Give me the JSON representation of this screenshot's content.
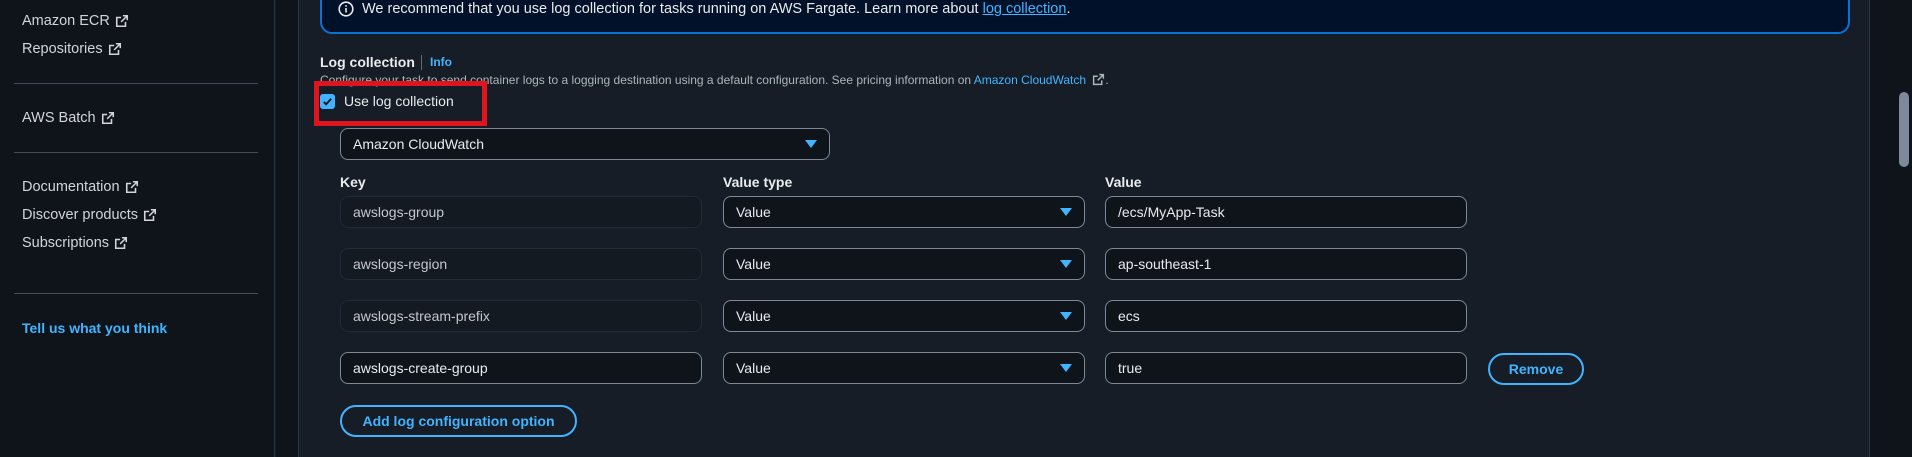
{
  "sidebar": {
    "items_top": [
      {
        "label": "Amazon ECR"
      },
      {
        "label": "Repositories"
      }
    ],
    "items_mid": [
      {
        "label": "AWS Batch"
      }
    ],
    "items_bottom": [
      {
        "label": "Documentation"
      },
      {
        "label": "Discover products"
      },
      {
        "label": "Subscriptions"
      }
    ],
    "feedback": "Tell us what you think"
  },
  "alert": {
    "text": "We recommend that you use log collection for tasks running on AWS Fargate. Learn more about ",
    "link": "log collection",
    "suffix": "."
  },
  "log_collection": {
    "title": "Log collection",
    "info": "Info",
    "description": "Configure your task to send container logs to a logging destination using a default configuration. See pricing information on ",
    "description_link": "Amazon CloudWatch",
    "description_suffix": ".",
    "checkbox_label": "Use log collection",
    "checkbox_checked": true,
    "destination": "Amazon CloudWatch",
    "columns": {
      "key": "Key",
      "value_type": "Value type",
      "value": "Value"
    },
    "rows": [
      {
        "key": "awslogs-group",
        "value_type": "Value",
        "value": "/ecs/MyApp-Task"
      },
      {
        "key": "awslogs-region",
        "value_type": "Value",
        "value": "ap-southeast-1"
      },
      {
        "key": "awslogs-stream-prefix",
        "value_type": "Value",
        "value": "ecs"
      },
      {
        "key": "awslogs-create-group",
        "value_type": "Value",
        "value": "true",
        "remove": "Remove"
      }
    ],
    "add_button": "Add log configuration option"
  },
  "colors": {
    "accent": "#42b4ff",
    "highlight": "#e0141e",
    "background": "#161d26"
  }
}
